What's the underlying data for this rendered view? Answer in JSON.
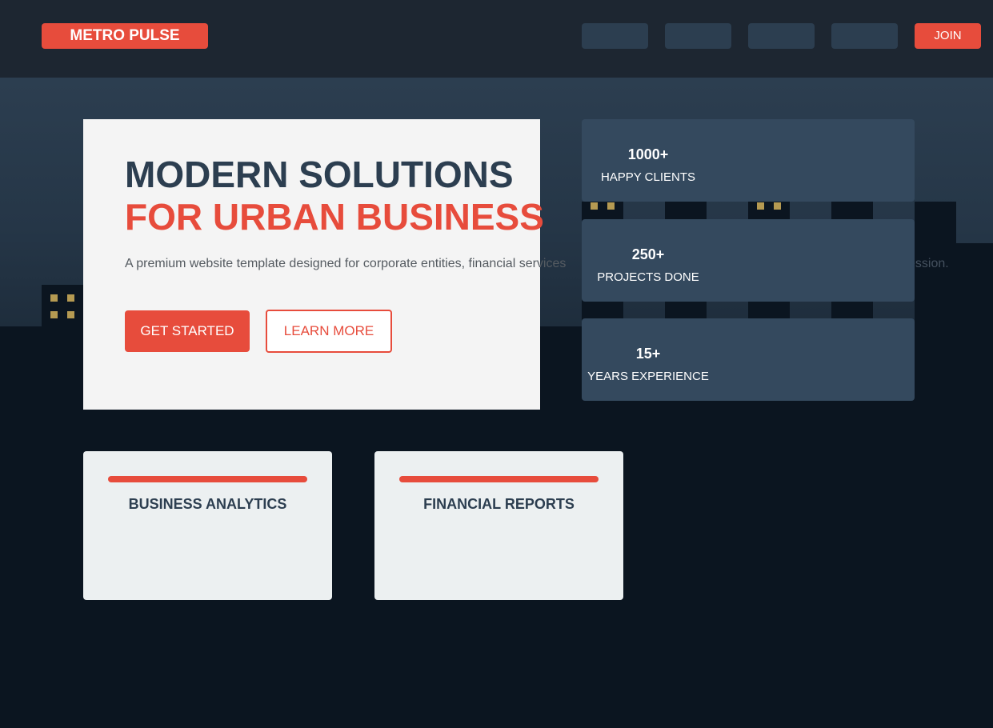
{
  "header": {
    "logo": "METRO PULSE",
    "join_label": "JOIN"
  },
  "hero": {
    "title_line1": "MODERN SOLUTIONS",
    "title_line2": "FOR URBAN BUSINESS",
    "description": "A premium website template designed for corporate entities, financial services",
    "description_tail": "ession.",
    "primary_button": "GET STARTED",
    "secondary_button": "LEARN MORE"
  },
  "stats": [
    {
      "value": "1000+",
      "label": "HAPPY CLIENTS"
    },
    {
      "value": "250+",
      "label": "PROJECTS DONE"
    },
    {
      "value": "15+",
      "label": "YEARS EXPERIENCE"
    }
  ],
  "features": [
    {
      "title": "BUSINESS ANALYTICS"
    },
    {
      "title": "FINANCIAL REPORTS"
    }
  ],
  "colors": {
    "accent": "#e74c3c",
    "dark": "#2c3e50",
    "card": "#34495e",
    "window": "#b59a52"
  }
}
